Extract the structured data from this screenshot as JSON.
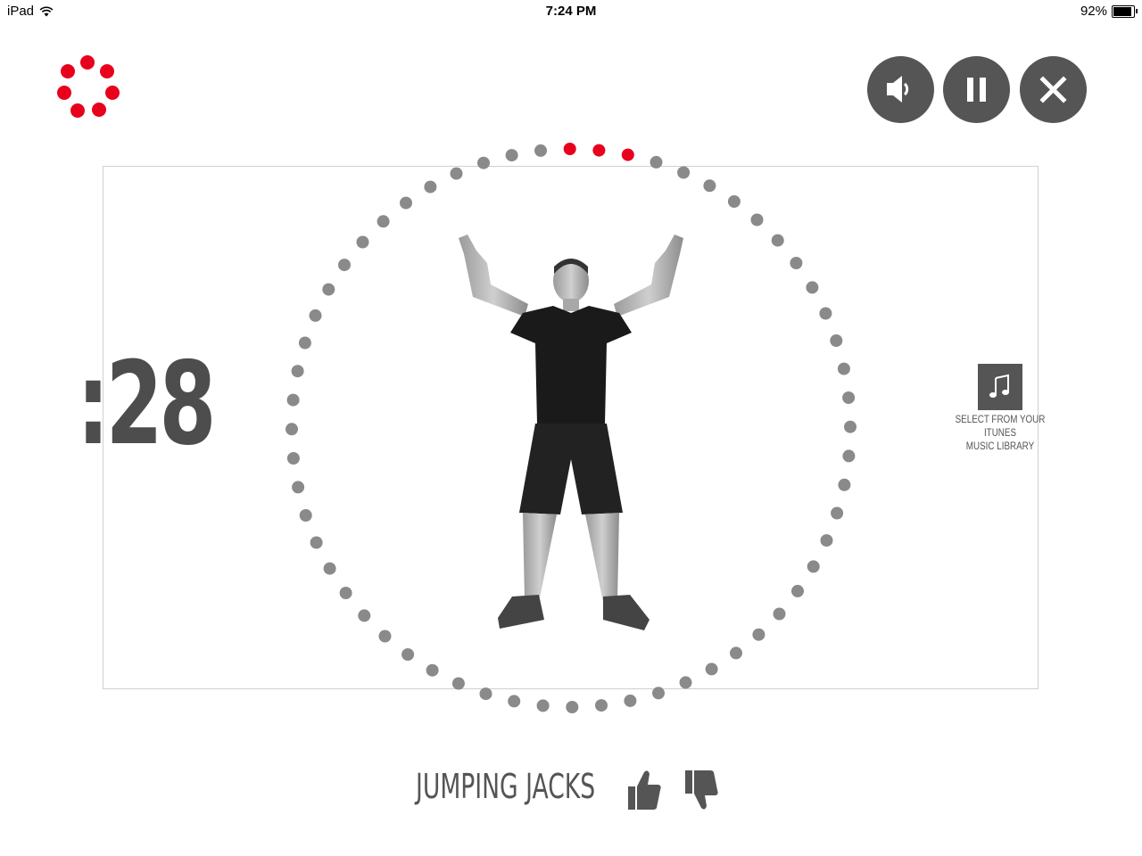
{
  "status_bar": {
    "device": "iPad",
    "time": "7:24 PM",
    "battery": "92%",
    "battery_level": 0.92
  },
  "controls": {
    "sound_icon": "speaker-icon",
    "pause_icon": "pause-icon",
    "close_icon": "close-icon"
  },
  "timer": ":28",
  "progress": {
    "total_dots": 60,
    "completed_dots": 3
  },
  "music": {
    "icon": "music-note-icon",
    "label": "SELECT FROM YOUR iTUNES\nMUSIC LIBRARY"
  },
  "exercise": {
    "name": "JUMPING JACKS"
  },
  "colors": {
    "accent_red": "#e8001c",
    "dot_gray": "#8a8a8a",
    "button_gray": "#555555",
    "text_gray": "#555555"
  }
}
